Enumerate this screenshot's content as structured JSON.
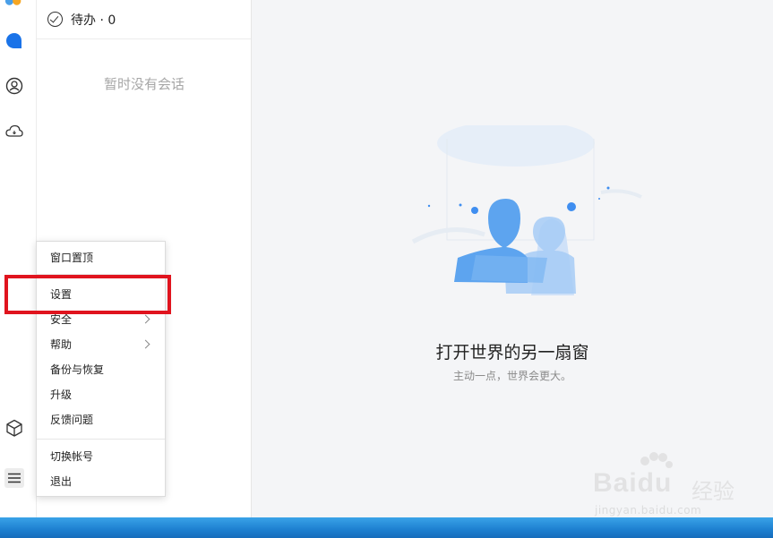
{
  "todo": {
    "label": "待办 · 0"
  },
  "sessions": {
    "empty_text": "暂时没有会话"
  },
  "main": {
    "title": "打开世界的另一扇窗",
    "subtitle": "主动一点，世界会更大。"
  },
  "menu": {
    "items": [
      {
        "label": "窗口置顶"
      },
      {
        "label": "设置"
      },
      {
        "label": "安全"
      },
      {
        "label": "帮助"
      },
      {
        "label": "备份与恢复"
      },
      {
        "label": "升级"
      },
      {
        "label": "反馈问题"
      },
      {
        "label": "切换帐号"
      },
      {
        "label": "退出"
      }
    ]
  },
  "watermark": {
    "brand": "Baidu",
    "suffix": "经验",
    "url": "jingyan.baidu.com"
  },
  "colors": {
    "accent": "#1e90ff",
    "highlight": "#e0141e",
    "taskbar": "#1d7fd0"
  },
  "rail_icons": [
    "app-logo-icon",
    "message-icon",
    "contacts-icon",
    "cloud-icon",
    "cube-icon",
    "menu-icon"
  ]
}
